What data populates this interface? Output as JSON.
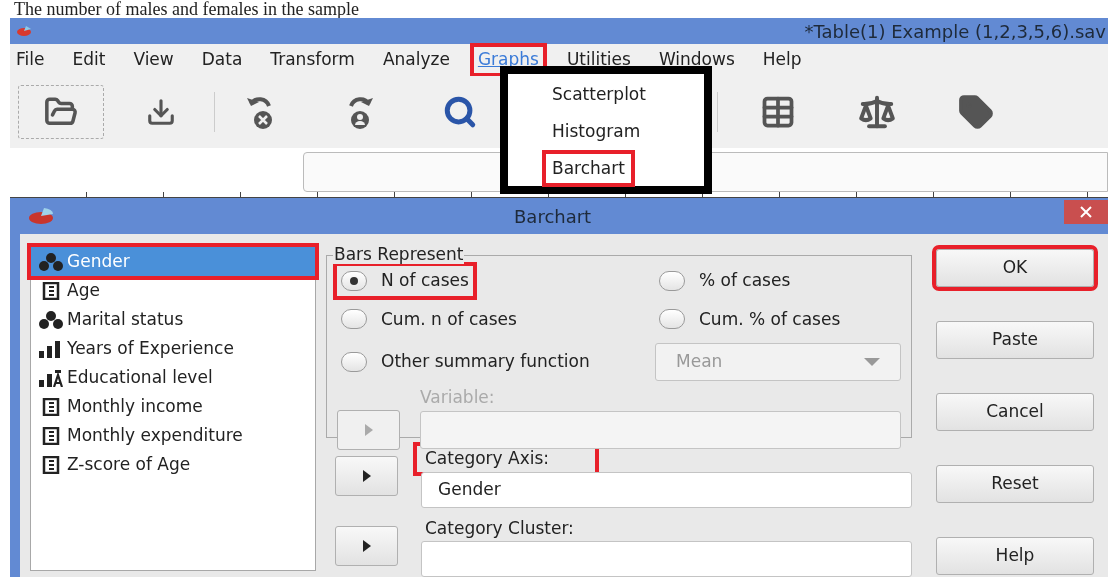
{
  "caption": "The number of males and females in the sample",
  "window": {
    "title": "*Table(1) Example (1,2,3,5,6).sav"
  },
  "menu_bar": [
    {
      "label": "File",
      "selected": false,
      "annotated": false
    },
    {
      "label": "Edit",
      "selected": false,
      "annotated": false
    },
    {
      "label": "View",
      "selected": false,
      "annotated": false
    },
    {
      "label": "Data",
      "selected": false,
      "annotated": false
    },
    {
      "label": "Transform",
      "selected": false,
      "annotated": false
    },
    {
      "label": "Analyze",
      "selected": false,
      "annotated": false
    },
    {
      "label": "Graphs",
      "selected": true,
      "annotated": true
    },
    {
      "label": "Utilities",
      "selected": false,
      "annotated": false
    },
    {
      "label": "Windows",
      "selected": false,
      "annotated": false
    },
    {
      "label": "Help",
      "selected": false,
      "annotated": false
    }
  ],
  "graphs_menu": [
    {
      "label": "Scatterplot",
      "annotated": false
    },
    {
      "label": "Histogram",
      "annotated": false
    },
    {
      "label": "Barchart",
      "annotated": true
    }
  ],
  "dialog": {
    "title": "Barchart",
    "variables": [
      {
        "name": "Gender",
        "kind": "nominal",
        "selected": true,
        "annotated": true
      },
      {
        "name": "Age",
        "kind": "scale",
        "selected": false,
        "annotated": false
      },
      {
        "name": "Marital status",
        "kind": "nominal",
        "selected": false,
        "annotated": false
      },
      {
        "name": "Years of Experience",
        "kind": "ordinal",
        "selected": false,
        "annotated": false
      },
      {
        "name": "Educational level",
        "kind": "ordinal_text",
        "selected": false,
        "annotated": false
      },
      {
        "name": "Monthly income",
        "kind": "scale",
        "selected": false,
        "annotated": false
      },
      {
        "name": "Monthly expenditure",
        "kind": "scale",
        "selected": false,
        "annotated": false
      },
      {
        "name": "Z-score of Age",
        "kind": "scale",
        "selected": false,
        "annotated": false
      }
    ],
    "bars_represent": {
      "title": "Bars Represent",
      "options": [
        {
          "label": "N of cases",
          "selected": true,
          "annotated": true
        },
        {
          "label": "% of cases",
          "selected": false,
          "annotated": false
        },
        {
          "label": "Cum. n of cases",
          "selected": false,
          "annotated": false
        },
        {
          "label": "Cum. % of cases",
          "selected": false,
          "annotated": false
        },
        {
          "label": "Other summary function",
          "selected": false,
          "annotated": false
        }
      ],
      "function": {
        "value": "Mean",
        "disabled": true
      },
      "variable": {
        "label": "Variable:",
        "disabled": true
      }
    },
    "category_axis": {
      "label": "Category Axis:",
      "value": "Gender",
      "annotated": true
    },
    "category_cluster": {
      "label": "Category Cluster:"
    },
    "buttons": [
      {
        "label": "OK",
        "annotated": true
      },
      {
        "label": "Paste",
        "annotated": false
      },
      {
        "label": "Cancel",
        "annotated": false
      },
      {
        "label": "Reset",
        "annotated": false
      },
      {
        "label": "Help",
        "annotated": false
      }
    ]
  }
}
